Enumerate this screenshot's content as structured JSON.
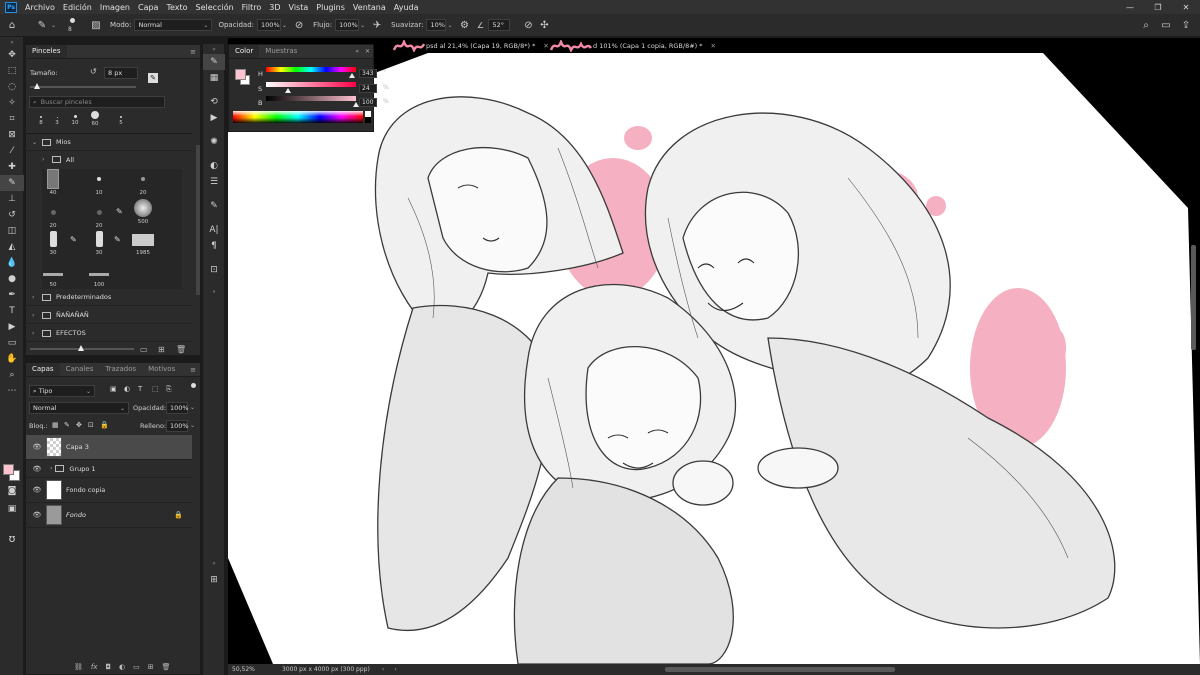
{
  "menu": [
    "Archivo",
    "Edición",
    "Imagen",
    "Capa",
    "Texto",
    "Selección",
    "Filtro",
    "3D",
    "Vista",
    "Plugins",
    "Ventana",
    "Ayuda"
  ],
  "app_logo": "Ps",
  "options": {
    "brush_size": "8",
    "mode_label": "Modo:",
    "mode_value": "Normal",
    "opacity_label": "Opacidad:",
    "opacity_value": "100%",
    "flow_label": "Flujo:",
    "flow_value": "100%",
    "smooth_label": "Suavizar:",
    "smooth_value": "10%",
    "angle_value": "52°"
  },
  "brushes": {
    "tab": "Pinceles",
    "size_label": "Tamaño:",
    "size_value": "8 px",
    "search_placeholder": "Buscar pinceles",
    "recent_sizes": [
      "8",
      "3",
      "10",
      "60",
      "5"
    ],
    "folders": {
      "mios": "Mios",
      "all": "All",
      "predeterminados": "Predeterminados",
      "nanananan": "ÑAÑAÑAÑ",
      "efectos": "EFECTOS"
    },
    "grid_sizes": [
      "40",
      "10",
      "20",
      "20",
      "20",
      "500",
      "30",
      "30",
      "1985",
      "50",
      "100"
    ]
  },
  "layers": {
    "tabs": [
      "Capas",
      "Canales",
      "Trazados",
      "Motivos"
    ],
    "filter_kind": "Tipo",
    "blend_mode": "Normal",
    "opacity_label": "Opacidad:",
    "opacity_value": "100%",
    "lock_label": "Bloq.:",
    "fill_label": "Relleno:",
    "fill_value": "100%",
    "items": [
      {
        "name": "Capa 3"
      },
      {
        "name": "Grupo 1"
      },
      {
        "name": "Fondo copia"
      },
      {
        "name": "Fondo"
      }
    ]
  },
  "color_panel": {
    "tabs": [
      "Color",
      "Muestras"
    ],
    "h_label": "H",
    "s_label": "S",
    "b_label": "B",
    "h_value": "343",
    "s_value": "24",
    "b_value": "100",
    "h_unit": "°",
    "s_unit": "%",
    "b_unit": "%",
    "h_level": 0.95,
    "s_level": 0.24,
    "b_level": 1.0,
    "foreground_color": "#ffc2d0"
  },
  "doc_tabs": [
    "psd al 21,4% (Capa 19, RGB/8*) *",
    "d 101% (Capa 1 copia, RGB/8#) *"
  ],
  "status": {
    "zoom": "50,52%",
    "doc_info": "3000 px x 4000 px (300 ppp)"
  },
  "colors": {
    "accent_pink": "#f4a9bd",
    "ui_dark": "#2b2b2b"
  }
}
